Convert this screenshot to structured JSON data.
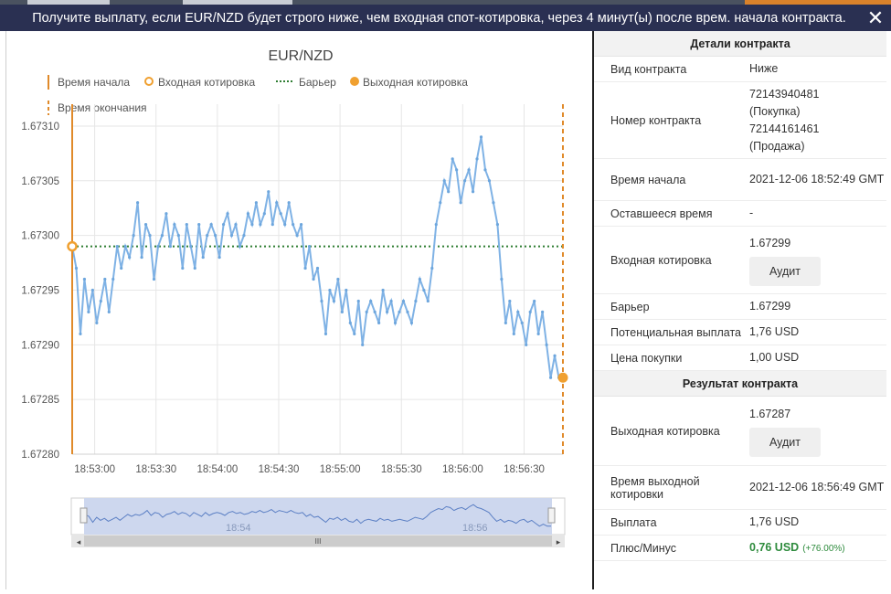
{
  "header": {
    "title": "Получите выплату, если EUR/NZD будет строго ниже, чем входная спот-котировка, через 4 минут(ы) после врем. начала контракта.",
    "close_glyph": "✕"
  },
  "chart_data": {
    "type": "line",
    "title": "EUR/NZD",
    "legend": [
      {
        "label": "Время начала",
        "style": "solid-line",
        "color": "#e08a2a"
      },
      {
        "label": "Входная котировка",
        "style": "hollow-dot",
        "color": "#f0a030"
      },
      {
        "label": "Барьер",
        "style": "dotted-line",
        "color": "#2e7d32"
      },
      {
        "label": "Выходная котировка",
        "style": "filled-dot",
        "color": "#f0a030"
      },
      {
        "label": "Время окончания",
        "style": "dashed-line",
        "color": "#e08a2a"
      }
    ],
    "legend_position": "top-left",
    "grid": true,
    "x_ticks": [
      "18:53:00",
      "18:53:30",
      "18:54:00",
      "18:54:30",
      "18:55:00",
      "18:55:30",
      "18:56:00",
      "18:56:30"
    ],
    "y_ticks": [
      "1.67280",
      "1.67285",
      "1.67290",
      "1.67295",
      "1.67300",
      "1.67305",
      "1.67310"
    ],
    "ylim": [
      1.6728,
      1.67312
    ],
    "xlim_seconds_after_18_52_49": [
      0,
      240
    ],
    "start_time": "18:52:49",
    "end_time": "18:56:49",
    "barrier": 1.67299,
    "entry": {
      "t": 0,
      "value": 1.67299
    },
    "exit": {
      "t": 240,
      "value": 1.67287
    },
    "series": [
      {
        "color": "#7fb2e5",
        "points": [
          [
            0,
            1.67299
          ],
          [
            2,
            1.67297
          ],
          [
            4,
            1.67291
          ],
          [
            6,
            1.67296
          ],
          [
            8,
            1.67293
          ],
          [
            10,
            1.67295
          ],
          [
            12,
            1.67292
          ],
          [
            14,
            1.67294
          ],
          [
            16,
            1.67296
          ],
          [
            18,
            1.67293
          ],
          [
            20,
            1.67296
          ],
          [
            22,
            1.67299
          ],
          [
            24,
            1.67297
          ],
          [
            26,
            1.67299
          ],
          [
            28,
            1.67298
          ],
          [
            30,
            1.673
          ],
          [
            32,
            1.67303
          ],
          [
            34,
            1.67298
          ],
          [
            36,
            1.67301
          ],
          [
            38,
            1.673
          ],
          [
            40,
            1.67296
          ],
          [
            42,
            1.67299
          ],
          [
            44,
            1.673
          ],
          [
            46,
            1.67302
          ],
          [
            48,
            1.67299
          ],
          [
            50,
            1.67301
          ],
          [
            52,
            1.673
          ],
          [
            54,
            1.67297
          ],
          [
            56,
            1.67301
          ],
          [
            58,
            1.67299
          ],
          [
            60,
            1.67297
          ],
          [
            62,
            1.67301
          ],
          [
            64,
            1.67298
          ],
          [
            66,
            1.673
          ],
          [
            68,
            1.67301
          ],
          [
            70,
            1.673
          ],
          [
            72,
            1.67298
          ],
          [
            74,
            1.67301
          ],
          [
            76,
            1.67302
          ],
          [
            78,
            1.673
          ],
          [
            80,
            1.67301
          ],
          [
            82,
            1.67299
          ],
          [
            84,
            1.673
          ],
          [
            86,
            1.67302
          ],
          [
            88,
            1.67301
          ],
          [
            90,
            1.67303
          ],
          [
            92,
            1.67301
          ],
          [
            94,
            1.67302
          ],
          [
            96,
            1.67304
          ],
          [
            98,
            1.67301
          ],
          [
            100,
            1.67303
          ],
          [
            102,
            1.67302
          ],
          [
            104,
            1.67301
          ],
          [
            106,
            1.67303
          ],
          [
            108,
            1.67301
          ],
          [
            110,
            1.673
          ],
          [
            112,
            1.67301
          ],
          [
            114,
            1.67297
          ],
          [
            116,
            1.67299
          ],
          [
            118,
            1.67296
          ],
          [
            120,
            1.67297
          ],
          [
            122,
            1.67294
          ],
          [
            124,
            1.67291
          ],
          [
            126,
            1.67295
          ],
          [
            128,
            1.67294
          ],
          [
            130,
            1.67296
          ],
          [
            132,
            1.67293
          ],
          [
            134,
            1.67295
          ],
          [
            136,
            1.67292
          ],
          [
            138,
            1.67291
          ],
          [
            140,
            1.67294
          ],
          [
            142,
            1.6729
          ],
          [
            144,
            1.67293
          ],
          [
            146,
            1.67294
          ],
          [
            148,
            1.67293
          ],
          [
            150,
            1.67292
          ],
          [
            152,
            1.67295
          ],
          [
            154,
            1.67293
          ],
          [
            156,
            1.67294
          ],
          [
            158,
            1.67292
          ],
          [
            160,
            1.67293
          ],
          [
            162,
            1.67294
          ],
          [
            164,
            1.67293
          ],
          [
            166,
            1.67292
          ],
          [
            168,
            1.67294
          ],
          [
            170,
            1.67296
          ],
          [
            172,
            1.67295
          ],
          [
            174,
            1.67294
          ],
          [
            176,
            1.67297
          ],
          [
            178,
            1.67301
          ],
          [
            180,
            1.67303
          ],
          [
            182,
            1.67305
          ],
          [
            184,
            1.67304
          ],
          [
            186,
            1.67307
          ],
          [
            188,
            1.67306
          ],
          [
            190,
            1.67303
          ],
          [
            192,
            1.67305
          ],
          [
            194,
            1.67306
          ],
          [
            196,
            1.67304
          ],
          [
            198,
            1.67307
          ],
          [
            200,
            1.67309
          ],
          [
            202,
            1.67306
          ],
          [
            204,
            1.67305
          ],
          [
            206,
            1.67303
          ],
          [
            208,
            1.67301
          ],
          [
            210,
            1.67296
          ],
          [
            212,
            1.67292
          ],
          [
            214,
            1.67294
          ],
          [
            216,
            1.67291
          ],
          [
            218,
            1.67293
          ],
          [
            220,
            1.67292
          ],
          [
            222,
            1.6729
          ],
          [
            224,
            1.67293
          ],
          [
            226,
            1.67294
          ],
          [
            228,
            1.67291
          ],
          [
            230,
            1.67293
          ],
          [
            232,
            1.6729
          ],
          [
            234,
            1.67287
          ],
          [
            236,
            1.67289
          ],
          [
            238,
            1.67287
          ],
          [
            240,
            1.67287
          ]
        ]
      }
    ]
  },
  "navigator": {
    "labels": [
      "18:54",
      "18:56"
    ],
    "scroll_glyph": "III",
    "left_arrow": "◂",
    "right_arrow": "▸",
    "handle_glyph": "⁞"
  },
  "details": {
    "title": "Детали контракта",
    "rows": {
      "type_label": "Вид контракта",
      "type_value": "Ниже",
      "id_label": "Номер контракта",
      "id_buy": "72143940481 (Покупка)",
      "id_sell": "72144161461 (Продажа)",
      "start_label": "Время начала",
      "start_value": "2021-12-06 18:52:49 GMT",
      "remaining_label": "Оставшееся время",
      "remaining_value": "-",
      "entry_label": "Входная котировка",
      "entry_value": "1.67299",
      "audit_label": "Аудит",
      "barrier_label": "Барьер",
      "barrier_value": "1.67299",
      "payout_label": "Потенциальная выплата",
      "payout_value": "1,76 USD",
      "price_label": "Цена покупки",
      "price_value": "1,00 USD"
    }
  },
  "result": {
    "title": "Результат контракта",
    "rows": {
      "exit_label": "Выходная котировка",
      "exit_value": "1.67287",
      "audit_label": "Аудит",
      "exit_time_label": "Время выходной котировки",
      "exit_time_value": "2021-12-06 18:56:49 GMT",
      "payout_label": "Выплата",
      "payout_value": "1,76 USD",
      "pnl_label": "Плюс/Минус",
      "pnl_value": "0,76 USD",
      "pnl_pct": "(+76.00%)"
    }
  }
}
